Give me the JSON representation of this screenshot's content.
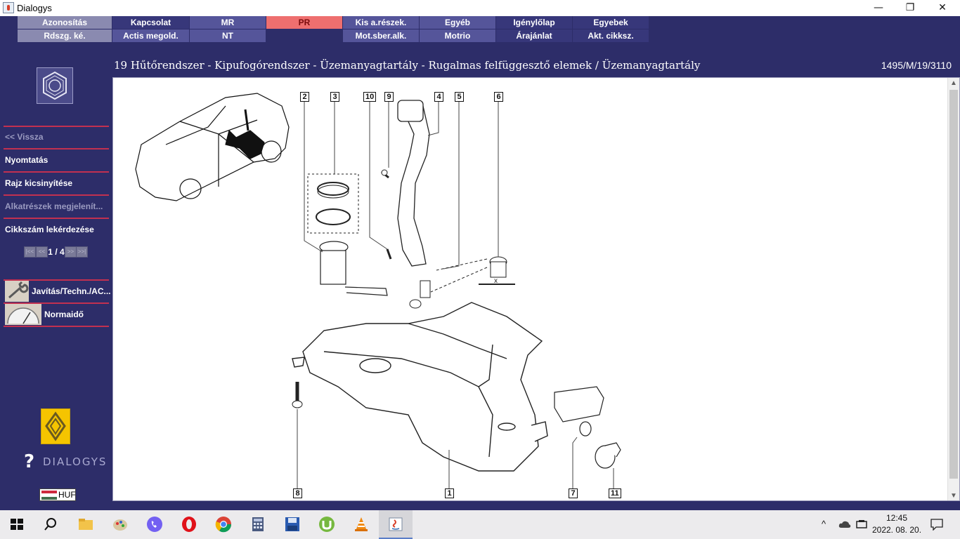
{
  "window": {
    "title": "Dialogys",
    "minimize_glyph": "—",
    "restore_glyph": "❐",
    "close_glyph": "✕"
  },
  "top_menu": {
    "row1": [
      "Azonosítás",
      "Kapcsolat",
      "MR",
      "PR",
      "Kis a.részek.",
      "Egyéb",
      "Igénylőlap",
      "Egyebek"
    ],
    "row2": [
      "Rdszg. ké.",
      "Actis megold.",
      "NT",
      "",
      "Mot.sber.alk.",
      "Motrio",
      "Árajánlat",
      "Akt. cikksz."
    ],
    "active": "PR"
  },
  "breadcrumb": "19 Hűtőrendszer - Kipufogórendszer - Üzemanyagtartály - Rugalmas felfüggesztő elemek / Üzemanyagtartály",
  "doc_code": "1495/M/19/3110",
  "sidebar": {
    "back": "<< Vissza",
    "print": "Nyomtatás",
    "zoom_out": "Rajz kicsinyítése",
    "show_parts": "Alkatrészek megjelenít...",
    "part_query": "Cikkszám lekérdezése",
    "pager": {
      "first": "|<<",
      "prev": "<<",
      "next": ">>",
      "last": ">>|",
      "current": "1",
      "separator": "/",
      "total": "4"
    },
    "repair": "Javítás/Techn./AC...",
    "labor_time": "Normaidő"
  },
  "brand": {
    "name": "DIALOGYS",
    "currency": "HUF"
  },
  "drawing": {
    "callouts": [
      "2",
      "3",
      "10",
      "9",
      "4",
      "5",
      "6",
      "8",
      "1",
      "7",
      "11"
    ],
    "dimension_label": "x"
  },
  "taskbar": {
    "time": "12:45",
    "date": "2022. 08. 20.",
    "tray_chevron": "^"
  },
  "colors": {
    "app_background": "#2d2d69",
    "active_tab": "#ee6f6f",
    "separator": "#c23050"
  }
}
